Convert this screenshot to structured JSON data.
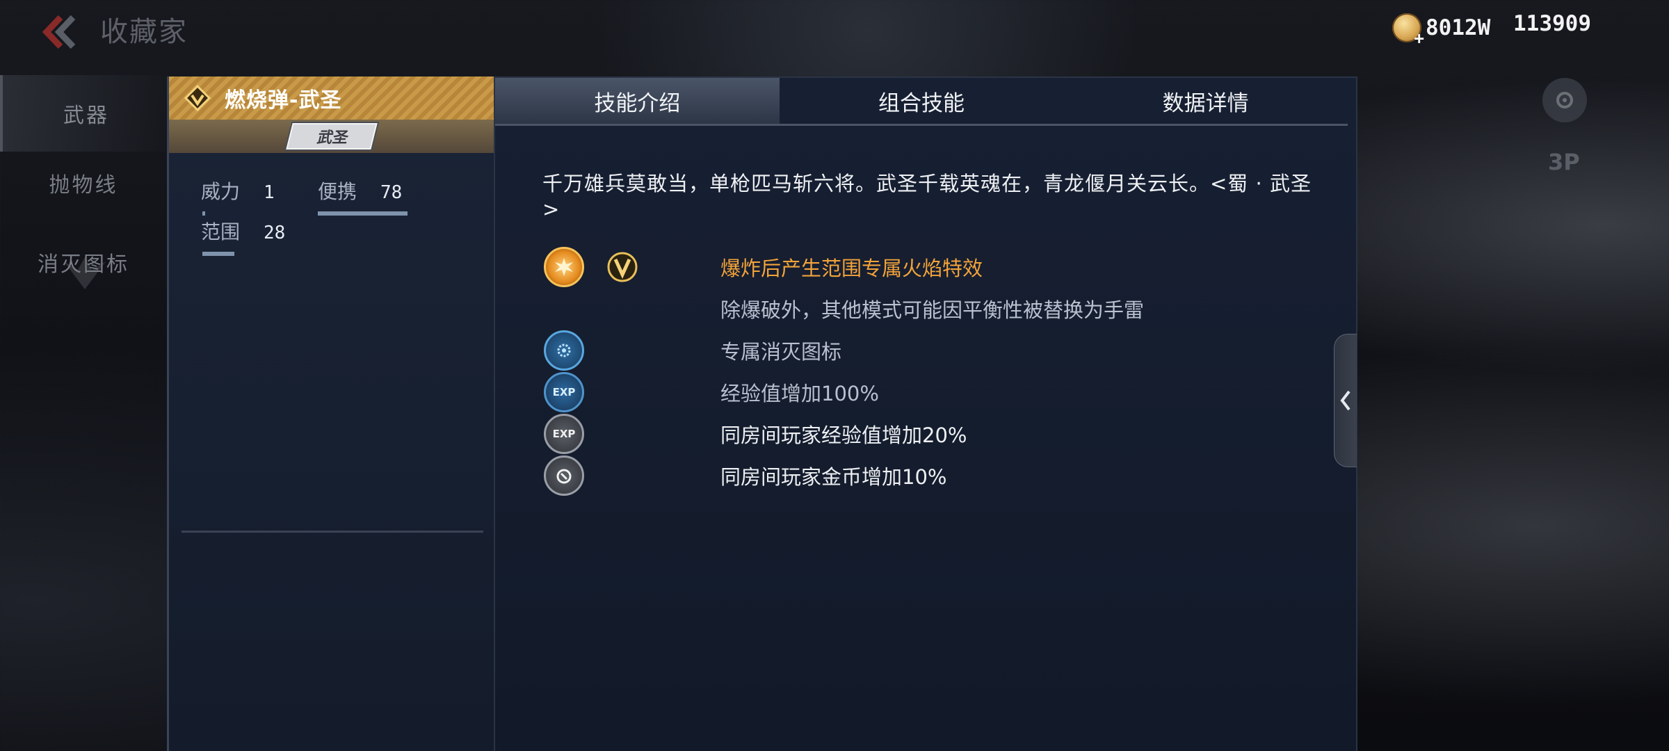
{
  "header": {
    "back_icon": "chevron-left-icon",
    "title": "收藏家",
    "gold_amount": "8012W",
    "gem_amount": "113909"
  },
  "nav": {
    "items": [
      {
        "label": "武器",
        "active": true
      },
      {
        "label": "抛物线",
        "active": false
      },
      {
        "label": "消灭图标",
        "active": false
      }
    ]
  },
  "side": {
    "view_label": "3P"
  },
  "weapon": {
    "name": "燃烧弹-武圣",
    "badge": "武圣",
    "stats": [
      {
        "label": "威力",
        "value": "1",
        "bar": 0.01
      },
      {
        "label": "便携",
        "value": "78",
        "bar": 0.78
      },
      {
        "label": "范围",
        "value": "28",
        "bar": 0.28
      }
    ]
  },
  "tabs": [
    {
      "label": "技能介绍",
      "active": true
    },
    {
      "label": "组合技能",
      "active": false
    },
    {
      "label": "数据详情",
      "active": false
    }
  ],
  "description": "千万雄兵莫敢当，单枪匹马斩六将。武圣千载英魂在，青龙偃月关云长。<蜀 · 武圣>",
  "skills": [
    {
      "icon": "explosion-icon",
      "text": "爆炸后产生范围专属火焰特效",
      "color": "#f3a33a"
    },
    {
      "icon": "",
      "text": "除爆破外，其他模式可能因平衡性被替换为手雷",
      "color": "#b9c1cf"
    },
    {
      "icon": "elimination-icon",
      "text": "专属消灭图标",
      "color": "#b9c1cf"
    },
    {
      "icon": "exp-icon",
      "text": "经验值增加100%",
      "color": "#b9c1cf"
    },
    {
      "icon": "room-exp-icon",
      "text": "同房间玩家经验值增加20%",
      "color": "#eef0f3"
    },
    {
      "icon": "room-coin-icon",
      "text": "同房间玩家金币增加10%",
      "color": "#eef0f3"
    }
  ],
  "colors": {
    "accent_gold": "#c99b49",
    "active_tab": "#4a5568",
    "skill_highlight": "#f3a33a"
  }
}
